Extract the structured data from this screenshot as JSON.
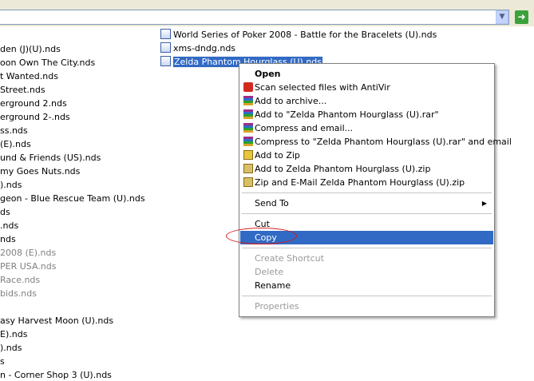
{
  "address_bar": {
    "value": ""
  },
  "left_files": [
    {
      "label": "den (J)(U).nds"
    },
    {
      "label": "oon Own The City.nds"
    },
    {
      "label": "t Wanted.nds"
    },
    {
      "label": "Street.nds"
    },
    {
      "label": "erground 2.nds"
    },
    {
      "label": "erground 2-.nds"
    },
    {
      "label": "ss.nds"
    },
    {
      "label": "(E).nds"
    },
    {
      "label": "und & Friends (US).nds"
    },
    {
      "label": "my Goes Nuts.nds"
    },
    {
      "label": ").nds"
    },
    {
      "label": "geon - Blue Rescue Team (U).nds"
    },
    {
      "label": "ds"
    },
    {
      "label": ".nds"
    },
    {
      "label": "nds"
    },
    {
      "label": "2008 (E).nds"
    },
    {
      "label": "PER USA.nds"
    },
    {
      "label": "Race.nds"
    },
    {
      "label": "bids.nds"
    },
    {
      "label": ""
    },
    {
      "label": "asy Harvest Moon (U).nds"
    },
    {
      "label": "E).nds"
    },
    {
      "label": ").nds"
    },
    {
      "label": "s"
    },
    {
      "label": "n - Corner Shop 3 (U).nds"
    }
  ],
  "right_files": [
    {
      "label": "World Series of Poker 2008 - Battle for the Bracelets (U).nds"
    },
    {
      "label": "xms-dndg.nds"
    },
    {
      "label": "Zelda Phantom Hourglass (U).nds"
    }
  ],
  "context_menu": {
    "items": [
      {
        "label": "Open",
        "icon": "none"
      },
      {
        "label": "Scan selected files with AntiVir",
        "icon": "antivir-icon"
      },
      {
        "label": "Add to archive...",
        "icon": "winrar-icon"
      },
      {
        "label": "Add to \"Zelda Phantom Hourglass (U).rar\"",
        "icon": "winrar-icon"
      },
      {
        "label": "Compress and email...",
        "icon": "winrar-icon"
      },
      {
        "label": "Compress to \"Zelda Phantom Hourglass (U).rar\" and email",
        "icon": "winrar-icon"
      },
      {
        "label": "Add to Zip",
        "icon": "winzip-icon"
      },
      {
        "label": "Add to Zelda Phantom Hourglass (U).zip",
        "icon": "winzip-icon"
      },
      {
        "label": "Zip and E-Mail Zelda Phantom Hourglass (U).zip",
        "icon": "winzip-icon"
      },
      {
        "label": "Send To"
      },
      {
        "label": "Cut"
      },
      {
        "label": "Copy"
      },
      {
        "label": "Create Shortcut"
      },
      {
        "label": "Delete"
      },
      {
        "label": "Rename"
      },
      {
        "label": "Properties"
      }
    ]
  },
  "colors": {
    "selection": "#316ac5",
    "annotation": "#d41818",
    "toolbar": "#ece9d8"
  }
}
